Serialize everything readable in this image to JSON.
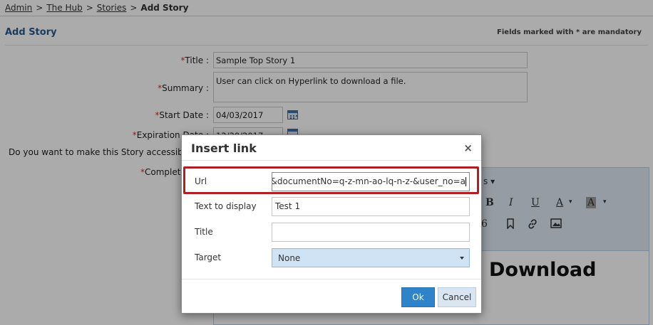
{
  "breadcrumb": {
    "items": [
      "Admin",
      "The Hub",
      "Stories"
    ],
    "separator": ">",
    "current": "Add Story"
  },
  "page": {
    "title": "Add Story",
    "mandatory_note": "Fields marked with * are mandatory"
  },
  "form": {
    "title_label": "Title :",
    "title_value": "Sample Top Story 1",
    "summary_label": "Summary :",
    "summary_value": "User can click on Hyperlink to download a file.",
    "start_date_label": "Start Date :",
    "start_date_value": "04/03/2017",
    "expiration_date_label": "Expiration Date :",
    "expiration_date_value": "12/30/2017",
    "accessible_question": "Do you want to make this Story accessible t",
    "complete_label": "Complete",
    "required_mark": "*"
  },
  "editor": {
    "body_text": "Download",
    "toolbar_fragment": "s"
  },
  "dialog": {
    "title": "Insert link",
    "close_symbol": "×",
    "url_label": "Url",
    "url_value": "n=L&documentNo=q-z-mn-ao-lq-n-z-&user_no=a",
    "text_label": "Text to display",
    "text_value": "Test 1",
    "title_label": "Title",
    "title_value": "",
    "target_label": "Target",
    "target_value": "None",
    "ok_label": "Ok",
    "cancel_label": "Cancel"
  },
  "colors": {
    "accent": "#2f83c8",
    "highlight_border": "#b01f24",
    "page_title": "#2a5a8c",
    "toolbar_bg": "#dfe9f3"
  },
  "icons": [
    "calendar-icon",
    "bold-icon",
    "italic-icon",
    "underline-icon",
    "font-color-icon",
    "highlight-color-icon",
    "bookmark-icon",
    "link-icon",
    "image-icon",
    "close-icon",
    "chevron-down-icon"
  ]
}
